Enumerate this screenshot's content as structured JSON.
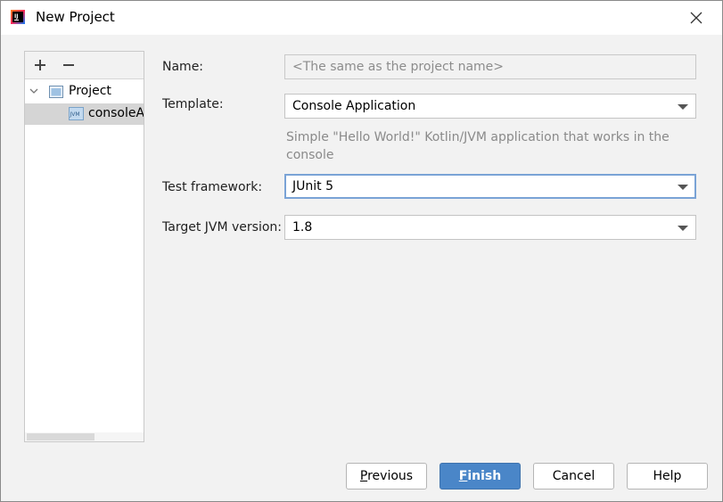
{
  "window": {
    "title": "New Project",
    "app_icon": "intellij-idea-icon",
    "close_icon": "close-icon"
  },
  "sidebar": {
    "toolbar": {
      "add_icon": "plus-icon",
      "remove_icon": "minus-icon"
    },
    "tree": [
      {
        "label": "Project",
        "expanded": true,
        "icon": "project-folder-icon",
        "selected": false
      },
      {
        "label": "consoleA",
        "icon": "jvm-module-icon",
        "badge": "JVM",
        "selected": true
      }
    ]
  },
  "form": {
    "name": {
      "label": "Name:",
      "value": "",
      "placeholder": "<The same as the project name>"
    },
    "template": {
      "label": "Template:",
      "value": "Console Application",
      "hint": "Simple \"Hello World!\" Kotlin/JVM application that works in the console"
    },
    "test_framework": {
      "label": "Test framework:",
      "value": "JUnit 5"
    },
    "target_jvm": {
      "label": "Target JVM version:",
      "value": "1.8"
    }
  },
  "buttons": {
    "previous": {
      "mnemonic": "P",
      "rest": "revious"
    },
    "finish": {
      "mnemonic": "F",
      "rest": "inish"
    },
    "cancel": "Cancel",
    "help": "Help"
  },
  "colors": {
    "primary_button": "#4a86c8",
    "focus_border": "#7aa3d6",
    "selection": "#d5d5d5"
  }
}
